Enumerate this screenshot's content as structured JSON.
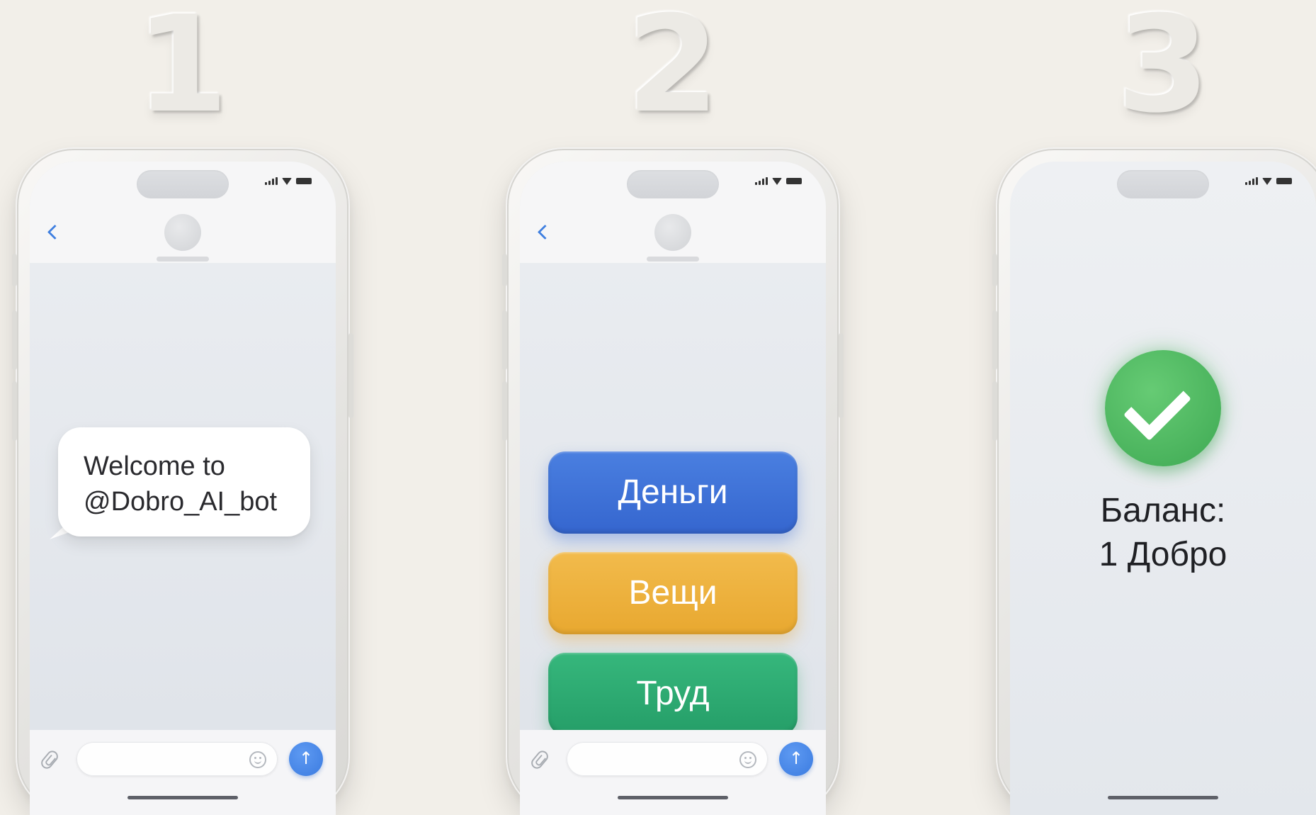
{
  "steps": [
    {
      "number": "1",
      "bubble": {
        "line1": "Welcome to",
        "line2": "@Dobro_AI_bot"
      },
      "input": {
        "placeholder": "",
        "send_glyph": "↑"
      }
    },
    {
      "number": "2",
      "buttons": [
        {
          "label": "Деньги",
          "color": "#3d70d8"
        },
        {
          "label": "Вещи",
          "color": "#eeb23d"
        },
        {
          "label": "Труд",
          "color": "#2eab72"
        }
      ],
      "input": {
        "placeholder": "",
        "send_glyph": "↑"
      }
    },
    {
      "number": "3",
      "balance": {
        "line1": "Баланс:",
        "line2": "1 Добро"
      },
      "success_color": "#4caf5f"
    }
  ],
  "icons": {
    "back": "chevron-left-icon",
    "attach": "paperclip-icon",
    "emoji": "smiley-icon",
    "send": "arrow-up-icon",
    "success": "checkmark-icon"
  },
  "colors": {
    "background": "#f2efe9",
    "accent_blue": "#3f7fe0"
  }
}
